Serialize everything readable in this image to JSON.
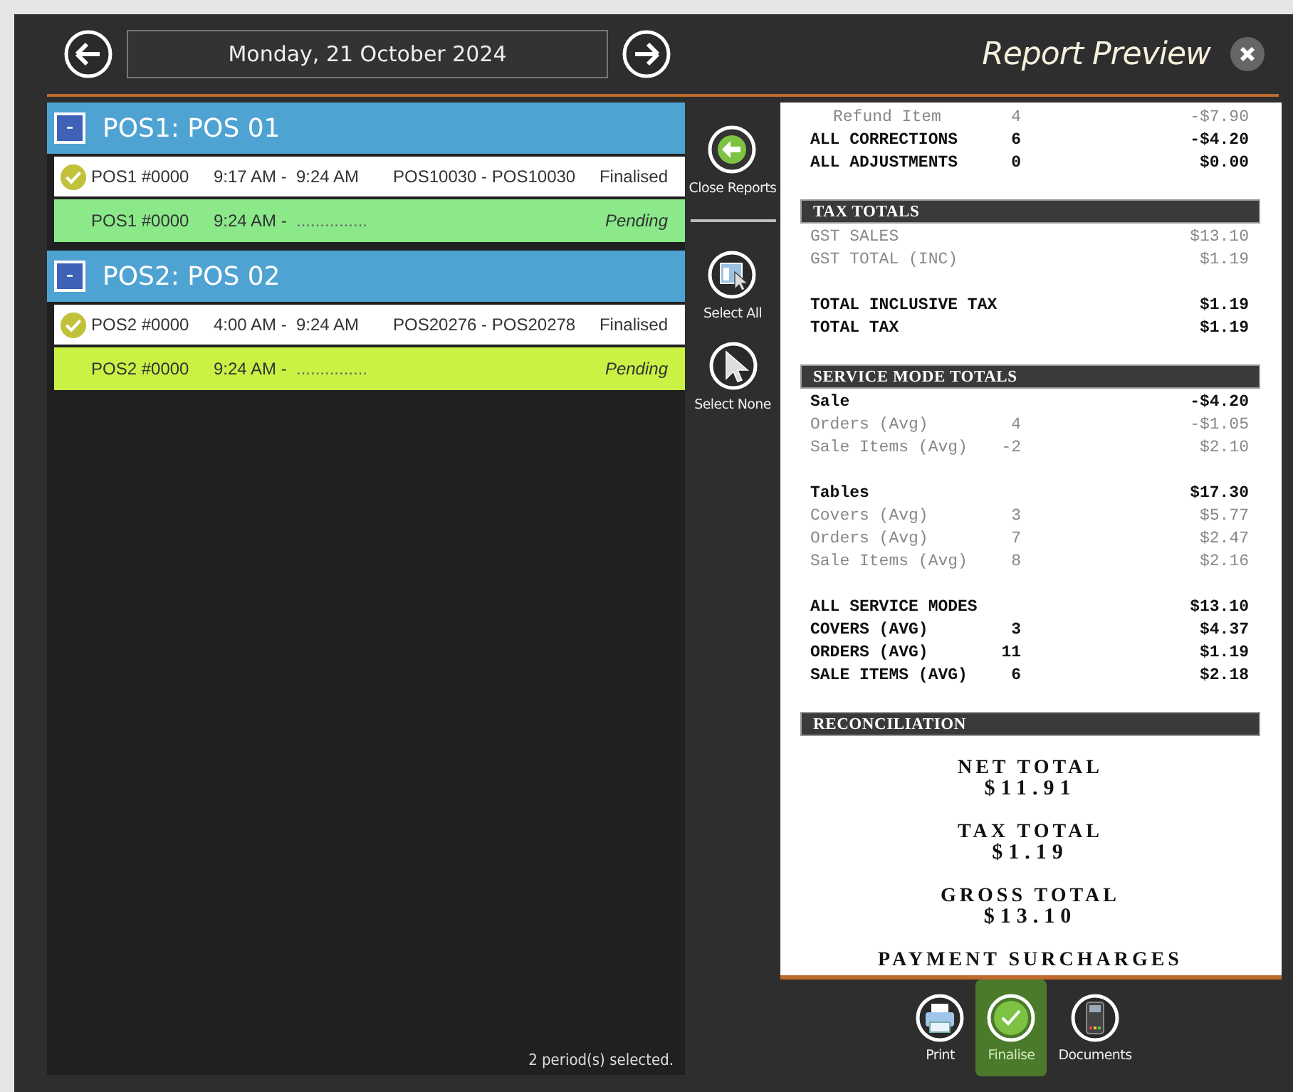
{
  "header": {
    "date": "Monday, 21 October 2024",
    "title": "Report Preview"
  },
  "groups": [
    {
      "title": "POS1: POS 01",
      "expanded": true,
      "toggle": "-",
      "periods": [
        {
          "kind": "finalised",
          "terminal": "POS1 #0000",
          "time_from": "9:17 AM -",
          "time_to": "9:24 AM",
          "range": "POS10030 - POS10030",
          "status": "Finalised"
        },
        {
          "kind": "pending",
          "color": "#8be98a",
          "terminal": "POS1 #0000",
          "time_from": "9:24 AM -",
          "time_to": "...............",
          "status": "Pending"
        }
      ]
    },
    {
      "title": "POS2: POS 02",
      "expanded": true,
      "toggle": "-",
      "periods": [
        {
          "kind": "finalised",
          "terminal": "POS2 #0000",
          "time_from": "4:00 AM -",
          "time_to": "9:24 AM",
          "range": "POS20276 - POS20278",
          "status": "Finalised"
        },
        {
          "kind": "pending",
          "color": "#c9f245",
          "terminal": "POS2 #0000",
          "time_from": "9:24 AM -",
          "time_to": "...............",
          "status": "Pending"
        }
      ]
    }
  ],
  "status": "2 period(s) selected.",
  "side_buttons": [
    {
      "kind": "close",
      "label": "Close Reports"
    },
    {
      "kind": "divider"
    },
    {
      "kind": "select_all",
      "label": "Select All"
    },
    {
      "kind": "select_none",
      "label": "Select None"
    }
  ],
  "report": [
    {
      "kind": "subrow",
      "bold": false,
      "label": "Refund Item",
      "count": "4",
      "amount": "-$7.90"
    },
    {
      "kind": "row",
      "bold": true,
      "label": "ALL CORRECTIONS",
      "count": "6",
      "amount": "-$4.20"
    },
    {
      "kind": "row",
      "bold": true,
      "label": "ALL ADJUSTMENTS",
      "count": "0",
      "amount": "$0.00"
    },
    {
      "kind": "gap"
    },
    {
      "kind": "header",
      "label": "TAX TOTALS"
    },
    {
      "kind": "row",
      "bold": false,
      "label": "GST SALES",
      "amount": "$13.10"
    },
    {
      "kind": "row",
      "bold": false,
      "label": "GST TOTAL (INC)",
      "amount": "$1.19"
    },
    {
      "kind": "gap"
    },
    {
      "kind": "row",
      "bold": true,
      "label": "TOTAL INCLUSIVE TAX",
      "amount": "$1.19"
    },
    {
      "kind": "row",
      "bold": true,
      "label": "TOTAL TAX",
      "amount": "$1.19"
    },
    {
      "kind": "gap"
    },
    {
      "kind": "header",
      "label": "SERVICE MODE TOTALS"
    },
    {
      "kind": "row",
      "bold": true,
      "label": "Sale",
      "amount": "-$4.20"
    },
    {
      "kind": "row",
      "bold": false,
      "label": "Orders (Avg)",
      "count": "4",
      "amount": "-$1.05"
    },
    {
      "kind": "row",
      "bold": false,
      "label": "Sale Items (Avg)",
      "count": "-2",
      "amount": "$2.10"
    },
    {
      "kind": "gap"
    },
    {
      "kind": "row",
      "bold": true,
      "label": "Tables",
      "amount": "$17.30"
    },
    {
      "kind": "row",
      "bold": false,
      "label": "Covers (Avg)",
      "count": "3",
      "amount": "$5.77"
    },
    {
      "kind": "row",
      "bold": false,
      "label": "Orders (Avg)",
      "count": "7",
      "amount": "$2.47"
    },
    {
      "kind": "row",
      "bold": false,
      "label": "Sale Items (Avg)",
      "count": "8",
      "amount": "$2.16"
    },
    {
      "kind": "gap"
    },
    {
      "kind": "row",
      "bold": true,
      "label": "ALL SERVICE MODES",
      "amount": "$13.10"
    },
    {
      "kind": "row",
      "bold": true,
      "label": "COVERS (AVG)",
      "count": "3",
      "amount": "$4.37"
    },
    {
      "kind": "row",
      "bold": true,
      "label": "ORDERS (AVG)",
      "count": "11",
      "amount": "$1.19"
    },
    {
      "kind": "row",
      "bold": true,
      "label": "SALE ITEMS (AVG)",
      "count": "6",
      "amount": "$2.18"
    },
    {
      "kind": "gap"
    },
    {
      "kind": "header",
      "label": "RECONCILIATION"
    },
    {
      "kind": "big",
      "label": "NET TOTAL",
      "amount": "$11.91"
    },
    {
      "kind": "big",
      "label": "TAX TOTAL",
      "amount": "$1.19"
    },
    {
      "kind": "big",
      "label": "GROSS TOTAL",
      "amount": "$13.10"
    },
    {
      "kind": "big",
      "label": "PAYMENT SURCHARGES"
    }
  ],
  "toolbar": [
    {
      "kind": "print",
      "label": "Print",
      "selected": false
    },
    {
      "kind": "finalise",
      "label": "Finalise",
      "selected": true
    },
    {
      "kind": "documents",
      "label": "Documents",
      "selected": false
    }
  ]
}
